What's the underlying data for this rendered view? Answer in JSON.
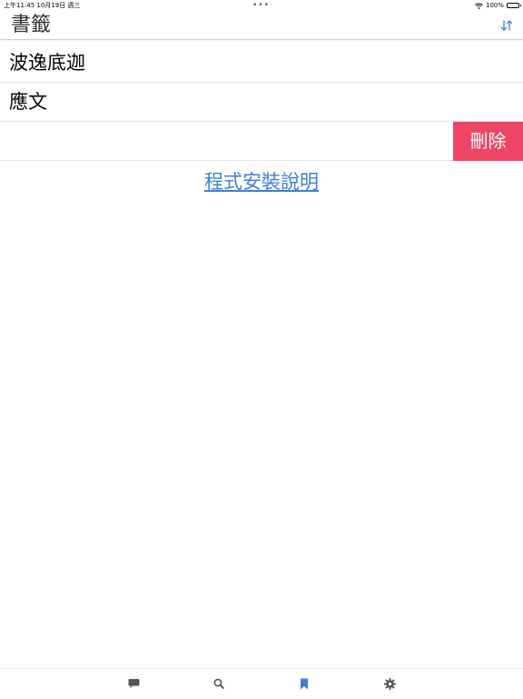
{
  "status_bar": {
    "time_date": "上午11:45   10月19日 週三",
    "dots": "•••",
    "battery_text": "100%",
    "battery_level": 1.0
  },
  "header": {
    "title": "書籤",
    "sort_icon": "sort-arrows-icon"
  },
  "bookmarks": {
    "items": [
      {
        "label": "波逸底迦"
      },
      {
        "label": "應文"
      },
      {
        "label": ""
      }
    ],
    "delete_label": "刪除"
  },
  "help_link": "程式安裝說明",
  "tab_bar": {
    "tabs": [
      {
        "icon": "chat-icon",
        "active": false
      },
      {
        "icon": "search-icon",
        "active": false
      },
      {
        "icon": "bookmark-icon",
        "active": true
      },
      {
        "icon": "gear-icon",
        "active": false
      }
    ]
  },
  "colors": {
    "accent": "#3d7fd6",
    "delete": "#ef4565",
    "tab_inactive": "#555555"
  }
}
